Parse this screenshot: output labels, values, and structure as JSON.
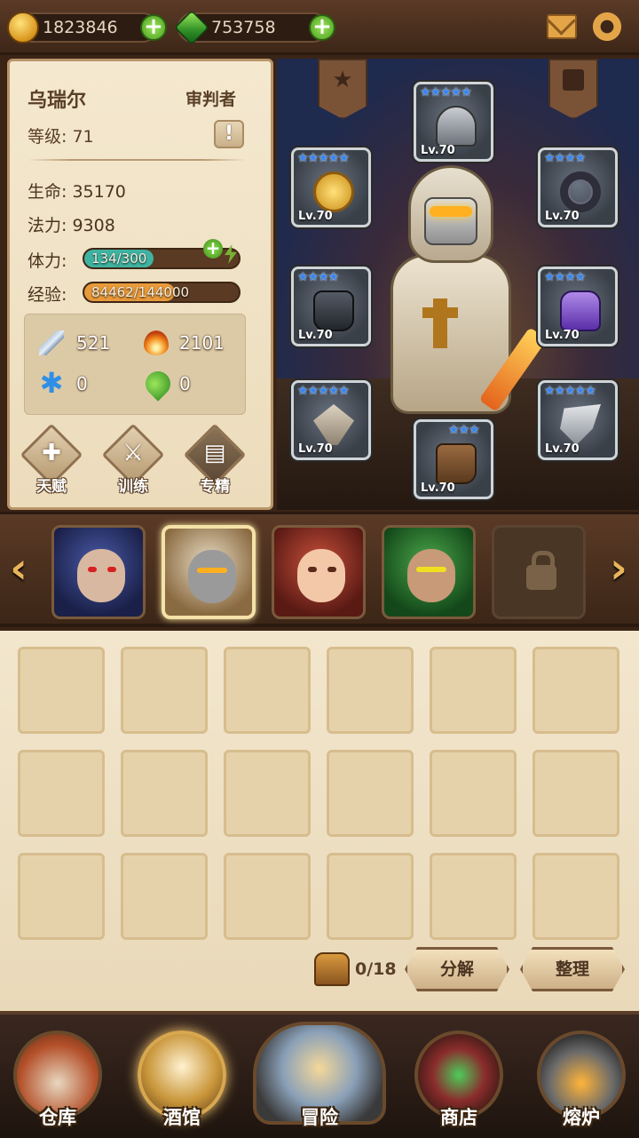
{
  "resources": {
    "gold": "1823846",
    "gems": "753758"
  },
  "hero": {
    "name": "乌瑞尔",
    "class": "审判者",
    "level_label": "等级: 71",
    "hp_label": "生命: 35170",
    "mp_label": "法力: 9308",
    "stamina_label": "体力:",
    "stamina_text": "134/300",
    "stamina_value": 134,
    "stamina_max": 300,
    "exp_label": "经验:",
    "exp_text": "84462/144000",
    "exp_value": 84462,
    "exp_max": 144000,
    "attack": "521",
    "fire": "2101",
    "ice": "0",
    "nature": "0",
    "info_glyph": "!"
  },
  "actions": [
    {
      "label": "天赋",
      "glyph": "✚"
    },
    {
      "label": "训练",
      "glyph": "⚔"
    },
    {
      "label": "专精",
      "glyph": "▤"
    }
  ],
  "equipment": [
    {
      "slot": "helmet",
      "stars": "★★★★★",
      "level": "Lv.70"
    },
    {
      "slot": "amulet",
      "stars": "★★★★★",
      "level": "Lv.70"
    },
    {
      "slot": "ring",
      "stars": "★★★★",
      "level": "Lv.70"
    },
    {
      "slot": "gauntlet",
      "stars": "★★★★",
      "level": "Lv.70"
    },
    {
      "slot": "armor",
      "stars": "★★★★",
      "level": "Lv.70"
    },
    {
      "slot": "offhand",
      "stars": "★★★★★",
      "level": "Lv.70"
    },
    {
      "slot": "weapon",
      "stars": "★★★★★",
      "level": "Lv.70"
    },
    {
      "slot": "boots",
      "stars": "★★★",
      "level": "Lv.70"
    }
  ],
  "carousel": {
    "prev": "‹",
    "next": "›"
  },
  "inventory": {
    "capacity": "0/18",
    "decompose_label": "分解",
    "sort_label": "整理"
  },
  "nav": [
    {
      "label": "仓库",
      "icon": "warehouse-icon"
    },
    {
      "label": "酒馆",
      "icon": "tavern-icon"
    },
    {
      "label": "冒险",
      "icon": "adventure-icon"
    },
    {
      "label": "商店",
      "icon": "shop-icon"
    },
    {
      "label": "熔炉",
      "icon": "forge-icon"
    }
  ],
  "colors": {
    "stamina_fill": "#3fb3a2",
    "exp_fill": "#e89a3a",
    "star": "#3a86ef"
  }
}
